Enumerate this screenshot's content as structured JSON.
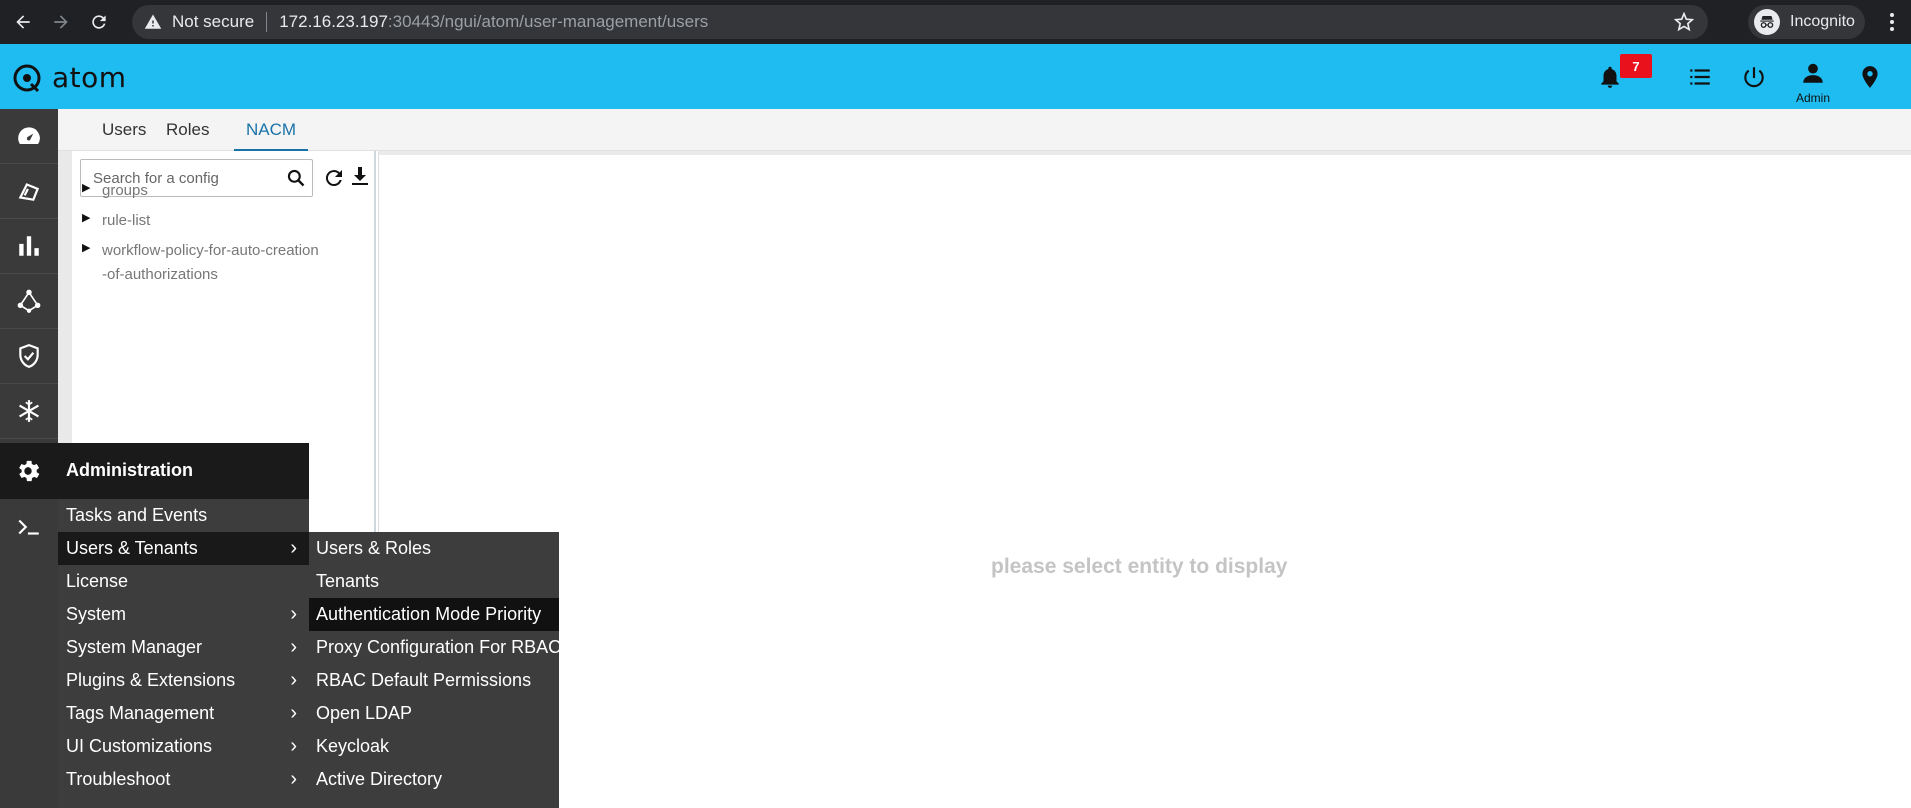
{
  "browser": {
    "security_label": "Not secure",
    "url_host": "172.16.23.197",
    "url_rest": ":30443/ngui/atom/user-management/users",
    "profile_label": "Incognito"
  },
  "header": {
    "logo_text": "atom",
    "notification_count": "7",
    "user_label": "Admin"
  },
  "tabs": [
    {
      "label": "Users"
    },
    {
      "label": "Roles"
    },
    {
      "label": "NACM"
    }
  ],
  "left_panel": {
    "search_placeholder": "Search for a config",
    "tree": [
      {
        "label": "groups"
      },
      {
        "label": "rule-list"
      },
      {
        "label": "workflow-policy-for-auto-creation-of-authorizations"
      }
    ]
  },
  "main": {
    "empty_message": "please select entity to display"
  },
  "admin_menu": {
    "title": "Administration",
    "items": [
      {
        "label": "Tasks and Events",
        "has_submenu": false
      },
      {
        "label": "Users & Tenants",
        "has_submenu": true
      },
      {
        "label": "License",
        "has_submenu": false
      },
      {
        "label": "System",
        "has_submenu": true
      },
      {
        "label": "System Manager",
        "has_submenu": true
      },
      {
        "label": "Plugins & Extensions",
        "has_submenu": true
      },
      {
        "label": "Tags Management",
        "has_submenu": true
      },
      {
        "label": "UI Customizations",
        "has_submenu": true
      },
      {
        "label": "Troubleshoot",
        "has_submenu": true
      }
    ],
    "submenu_items": [
      {
        "label": "Users & Roles"
      },
      {
        "label": "Tenants"
      },
      {
        "label": "Authentication Mode Priority"
      },
      {
        "label": "Proxy Configuration For RBAC"
      },
      {
        "label": "RBAC Default Permissions"
      },
      {
        "label": "Open LDAP"
      },
      {
        "label": "Keycloak"
      },
      {
        "label": "Active Directory"
      }
    ]
  },
  "colors": {
    "header_bg": "#1ebcf0",
    "active_tab": "#1a73a8",
    "badge": "#e8111c",
    "menu_bg": "#3d3d3d",
    "menu_hover": "#191919"
  }
}
